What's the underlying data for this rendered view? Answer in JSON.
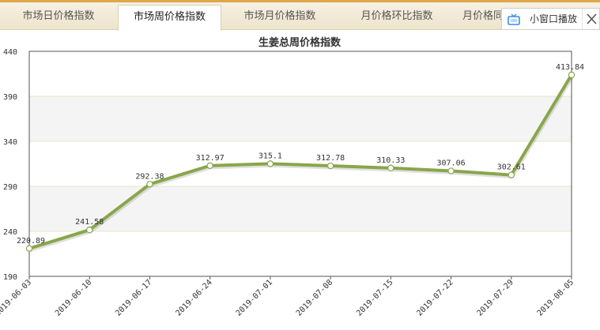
{
  "tabs": [
    {
      "label": "市场日价格指数",
      "active": false
    },
    {
      "label": "市场周价格指数",
      "active": true
    },
    {
      "label": "市场月价格指数",
      "active": false
    },
    {
      "label": "月价格环比指数",
      "active": false
    },
    {
      "label": "月价格同",
      "active": false
    }
  ],
  "float_panel": {
    "label": "小窗口播放",
    "icon": "tv-icon",
    "close_icon": "close-icon"
  },
  "colors": {
    "line": "#8aa64a",
    "band": "#f4f4f4",
    "tab_bar": "#f2ebd8",
    "accent_top": "#e0a64a",
    "tv_icon": "#3a8ee6"
  },
  "chart_data": {
    "type": "line",
    "title": "生姜总周价格指数",
    "xlabel": "",
    "ylabel": "",
    "categories": [
      "2019-06-03",
      "2019-06-10",
      "2019-06-17",
      "2019-06-24",
      "2019-07-01",
      "2019-07-08",
      "2019-07-15",
      "2019-07-22",
      "2019-07-29",
      "2019-08-05"
    ],
    "values": [
      220.89,
      241.58,
      292.38,
      312.97,
      315.1,
      312.78,
      310.33,
      307.06,
      302.61,
      413.84
    ],
    "labels": [
      "220.89",
      "241.58",
      "292.38",
      "312.97",
      "315.1",
      "312.78",
      "310.33",
      "307.06",
      "302.61",
      "413.84"
    ],
    "ylim": [
      190,
      440
    ],
    "yticks": [
      190,
      240,
      290,
      340,
      390,
      440
    ],
    "grid": true,
    "alternating_bands": true,
    "legend": "none"
  }
}
